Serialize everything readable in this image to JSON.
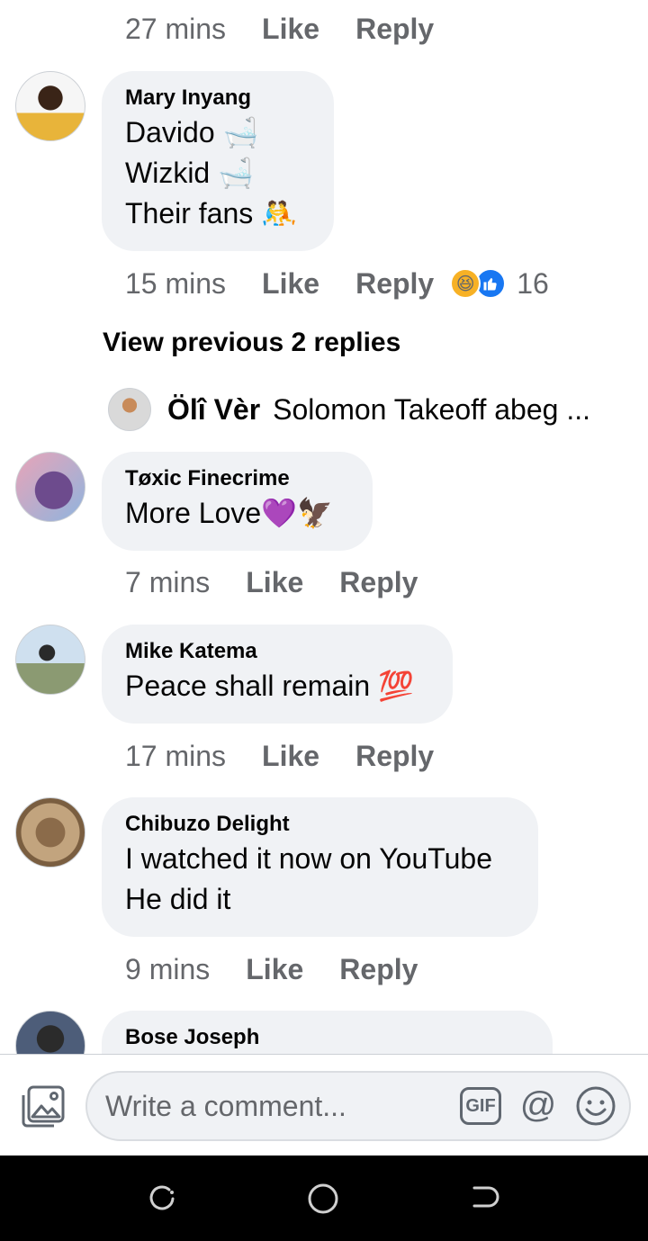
{
  "top_meta": {
    "time": "27 mins",
    "like": "Like",
    "reply": "Reply"
  },
  "comments": [
    {
      "name": "Mary Inyang",
      "lines": [
        "Davido 🛁",
        "Wizkid 🛁",
        "Their fans 🤼"
      ],
      "time": "15 mins",
      "like": "Like",
      "reply": "Reply",
      "reactions": {
        "icons": [
          "haha",
          "like"
        ],
        "count": "16"
      }
    },
    {
      "name": "Tøxic  Finecrime",
      "lines": [
        "More Love💜🦅"
      ],
      "time": "7 mins",
      "like": "Like",
      "reply": "Reply"
    },
    {
      "name": "Mike Katema",
      "lines": [
        "Peace shall remain 💯"
      ],
      "time": "17 mins",
      "like": "Like",
      "reply": "Reply"
    },
    {
      "name": "Chibuzo Delight",
      "lines": [
        "I watched it now on YouTube",
        "He did it"
      ],
      "time": "9 mins",
      "like": "Like",
      "reply": "Reply"
    },
    {
      "name": "Bose Joseph",
      "lines": []
    }
  ],
  "view_previous": "View previous 2 replies",
  "reply_preview": {
    "name": "Ölî Vèr",
    "text": "Solomon Takeoff abeg ..."
  },
  "composer": {
    "placeholder": "Write a comment...",
    "gif_label": "GIF",
    "at_label": "@"
  },
  "icons": {
    "photo": "photo-icon",
    "gif": "gif-icon",
    "mention": "at-icon",
    "emoji": "smiley-icon",
    "recent": "recent-apps-icon",
    "home": "home-icon",
    "back": "back-icon"
  },
  "colors": {
    "bubble": "#f0f2f5",
    "meta_text": "#65676b",
    "like_blue": "#1877f2",
    "haha_yellow": "#f7b125"
  }
}
